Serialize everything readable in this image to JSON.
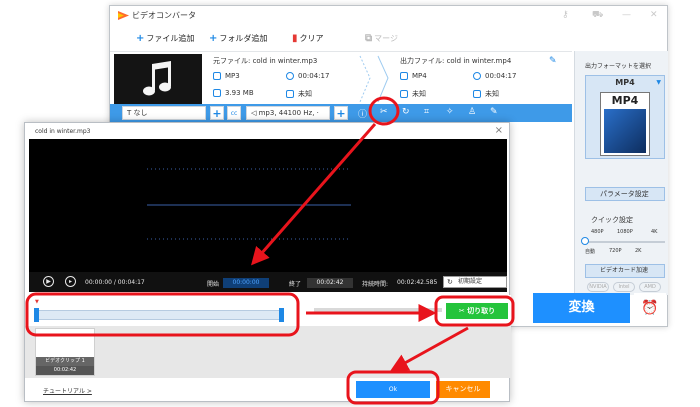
{
  "colors": {
    "accent": "#1e90ff",
    "edit_bar": "#3e9ae8",
    "cut_button": "#24c43b",
    "cancel_button": "#ff8a00",
    "annotation": "#e8141c"
  },
  "app": {
    "title": "ビデオコンバータ",
    "toolbar": {
      "add_file": "ファイル追加",
      "add_folder": "フォルダ追加",
      "clear": "クリア",
      "merge": "マージ"
    },
    "file": {
      "source_label": "元ファイル: cold in winter.mp3",
      "source_format": "MP3",
      "source_duration": "00:04:17",
      "source_size": "3.93 MB",
      "source_resolution": "未知",
      "output_label": "出力ファイル: cold in winter.mp4",
      "output_format": "MP4",
      "output_duration": "00:04:17",
      "output_size": "未知",
      "output_resolution": "未知"
    },
    "edit_bar": {
      "subtitle": "なし",
      "audio": "mp3, 44100 Hz, ·",
      "cc": "cc"
    },
    "right_panel": {
      "output_format_label": "出力フォーマットを選択",
      "format": "MP4",
      "format_icon_label": "MP4",
      "param_button": "パラメータ設定",
      "quick_setting": "クイック設定",
      "res_top": [
        "480P",
        "1080P",
        "4K"
      ],
      "res_bottom": [
        "自動",
        "720P",
        "2K"
      ],
      "gpu_button": "ビデオカード加速",
      "gpu_chips": [
        "NVIDIA",
        "Intel",
        "AMD"
      ]
    },
    "convert_button": "変換"
  },
  "dialog": {
    "title": "cold in winter.mp3",
    "current_time": "00:00:00 / 00:04:17",
    "start_label": "開始",
    "start_value": "00:00:00",
    "end_label": "終了",
    "end_value": "00:02:42",
    "duration_label": "持続時間:",
    "duration_value": "00:02:42.585",
    "reset_button": "初期設定",
    "cut_button": "切り取り",
    "clip_name": "ビデオクリップ 1",
    "clip_duration": "00:02:42",
    "tutorial": "チュートリアル >",
    "ok_button": "Ok",
    "cancel_button": "キャンセル"
  }
}
